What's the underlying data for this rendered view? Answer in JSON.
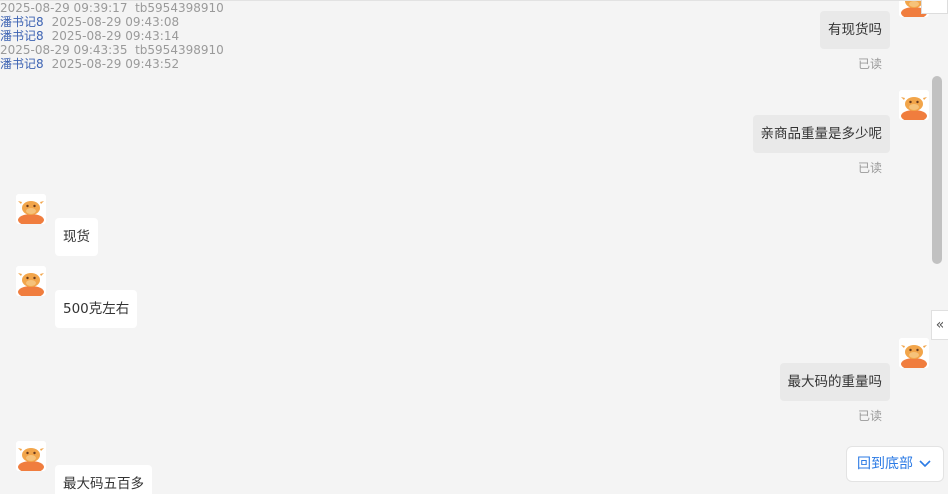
{
  "colors": {
    "background": "#f4f4f4",
    "name_link": "#3d63b3",
    "accent": "#2c7be5",
    "bubble_self": "#e9e9e9",
    "bubble_other": "#ffffff"
  },
  "messages": [
    {
      "side": "right",
      "text": "有现货吗",
      "read": "已读"
    },
    {
      "side": "right",
      "time": "2025-08-29 09:39:17",
      "user": "tb5954398910",
      "text": "亲商品重量是多少呢",
      "read": "已读"
    },
    {
      "side": "left",
      "user": "潘书记8",
      "time": "2025-08-29 09:43:08",
      "text": "现货"
    },
    {
      "side": "left",
      "user": "潘书记8",
      "time": "2025-08-29 09:43:14",
      "text": "500克左右"
    },
    {
      "side": "right",
      "time": "2025-08-29 09:43:35",
      "user": "tb5954398910",
      "text": "最大码的重量吗",
      "read": "已读"
    },
    {
      "side": "left",
      "user": "潘书记8",
      "time": "2025-08-29 09:43:52",
      "text": "最大码五百多"
    }
  ],
  "scroll_to_bottom": {
    "label": "回到底部",
    "icon": "chevron-down-icon"
  },
  "collapse": {
    "label": "«",
    "icon": "double-chevron-left-icon"
  }
}
